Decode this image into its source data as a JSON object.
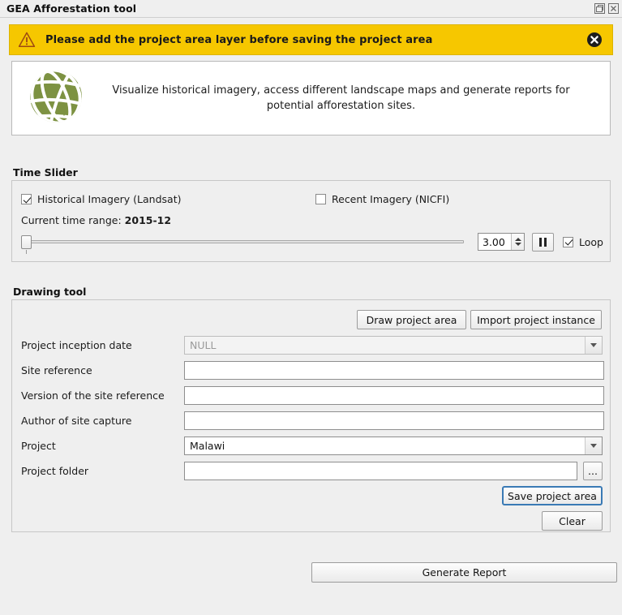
{
  "window": {
    "title": "GEA Afforestation tool",
    "float_icon": "float-window-icon",
    "close_icon": "close-window-icon"
  },
  "warning": {
    "icon": "warning-triangle-icon",
    "message": "Please add the project area layer before saving the project area",
    "close_icon": "close-icon",
    "background_color": "#f6c700",
    "text_color": "#1a1a1a"
  },
  "intro": {
    "logo_icon": "globe-logo-icon",
    "logo_color": "#7a9040",
    "description": "Visualize historical imagery, access different landscape maps and generate reports for potential afforestation sites."
  },
  "time_slider": {
    "title": "Time Slider",
    "historical_label": "Historical Imagery (Landsat)",
    "historical_checked": true,
    "recent_label": "Recent Imagery (NICFI)",
    "recent_checked": false,
    "time_range_prefix": "Current time range: ",
    "time_range_value": "2015-12",
    "slider_position_pct": 0,
    "speed_value": "3.00",
    "pause_icon": "pause-icon",
    "loop_label": "Loop",
    "loop_checked": true
  },
  "drawing_tool": {
    "title": "Drawing tool",
    "draw_button": "Draw project area",
    "import_button": "Import project instance",
    "fields": {
      "inception_date_label": "Project inception date",
      "inception_date_value": "NULL",
      "site_reference_label": "Site reference",
      "site_reference_value": "",
      "version_label": "Version of the site reference",
      "version_value": "",
      "author_label": "Author of site capture",
      "author_value": "",
      "project_label": "Project",
      "project_value": "Malawi",
      "project_folder_label": "Project folder",
      "project_folder_value": ""
    },
    "browse_button": "...",
    "save_button": "Save project area",
    "clear_button": "Clear"
  },
  "footer": {
    "generate_report_button": "Generate Report"
  }
}
